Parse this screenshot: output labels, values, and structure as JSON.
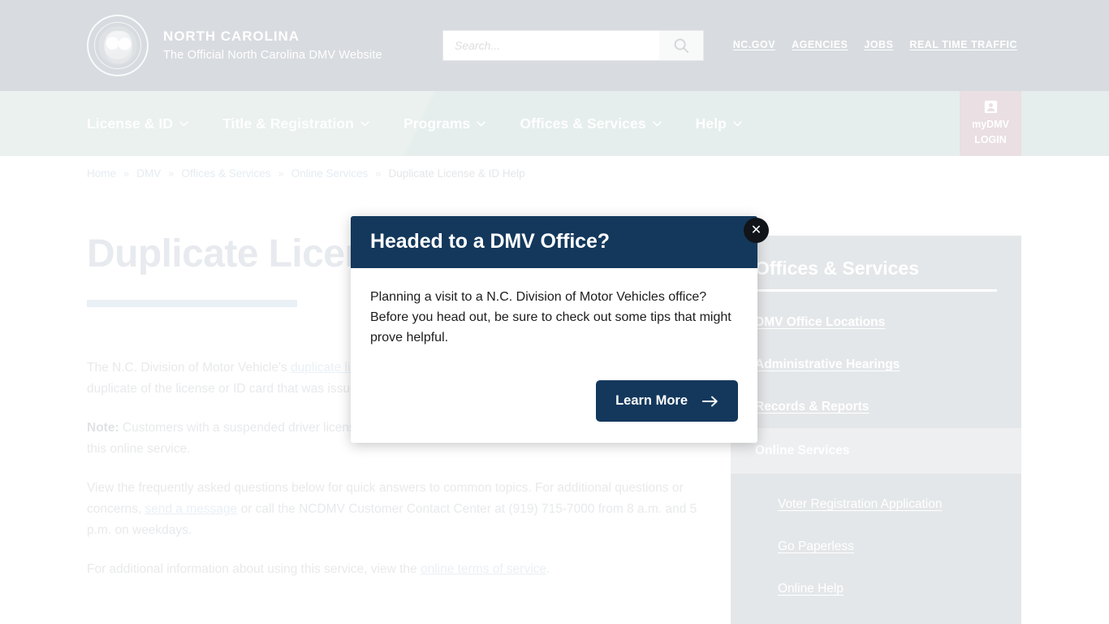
{
  "header": {
    "brand_title": "NORTH CAROLINA",
    "brand_subtitle": "The Official North Carolina DMV Website",
    "seal_icon": "nc-state-seal-icon",
    "search": {
      "placeholder": "Search...",
      "value": "",
      "icon": "search-icon"
    },
    "utility_links": [
      {
        "label": "NC.GOV"
      },
      {
        "label": "AGENCIES"
      },
      {
        "label": "JOBS"
      },
      {
        "label": "REAL TIME TRAFFIC"
      }
    ]
  },
  "nav": {
    "items": [
      {
        "label": "License & ID",
        "icon": "chevron-down-icon"
      },
      {
        "label": "Title & Registration",
        "icon": "chevron-down-icon"
      },
      {
        "label": "Programs",
        "icon": "chevron-down-icon"
      },
      {
        "label": "Offices & Services",
        "icon": "chevron-down-icon"
      },
      {
        "label": "Help",
        "icon": "chevron-down-icon"
      }
    ],
    "login": {
      "icon": "user-account-icon",
      "line1": "myDMV",
      "line2": "LOGIN"
    }
  },
  "breadcrumb": {
    "separator": "»",
    "items": [
      {
        "label": "Home",
        "current": false
      },
      {
        "label": "DMV",
        "current": false
      },
      {
        "label": "Offices & Services",
        "current": false
      },
      {
        "label": "Online Services",
        "current": false
      },
      {
        "label": "Duplicate License & ID Help",
        "current": true
      }
    ]
  },
  "main": {
    "page_title": "Duplicate License & ID Help",
    "paragraphs": {
      "p1_before": "The N.C. Division of Motor Vehicle's ",
      "p1_link": "duplicate license or ID service",
      "p1_after": " allows individuals to purchase online a duplicate of the license or ID card that was issued to them.",
      "p2_label": "Note:",
      "p2_text": " Customers with a suspended driver license or an outstanding debt with NCDMV are not eligible to use this online service.",
      "p3_before": "View the frequently asked questions below for quick answers to common topics. For additional questions or concerns, ",
      "p3_link": "send a message",
      "p3_after": " or call the NCDMV Customer Contact Center at (919) 715-7000 from 8 a.m. and 5 p.m. on weekdays.",
      "p4_before": "For additional information about using this service, view the ",
      "p4_link": "online terms of service",
      "p4_after": "."
    }
  },
  "sidebar": {
    "title": "Offices & Services",
    "links": [
      {
        "label": "DMV Office Locations"
      },
      {
        "label": "Administrative Hearings"
      },
      {
        "label": "Records & Reports"
      }
    ],
    "current": "Online Services",
    "sublinks": [
      {
        "label": "Voter Registration Application"
      },
      {
        "label": "Go Paperless"
      },
      {
        "label": "Online Help"
      }
    ]
  },
  "modal": {
    "title": "Headed to a DMV Office?",
    "close_label": "✕",
    "close_icon": "close-icon",
    "body": "Planning a visit to a N.C. Division of Motor Vehicles office? Before you head out, be sure to check out some tips that might prove helpful.",
    "button_label": "Learn More",
    "button_icon": "arrow-right-icon"
  },
  "colors": {
    "navy": "#13385c",
    "header_band": "#9aa1ab",
    "nav_band": "#bcd2cd",
    "login_band": "#c9aab2",
    "sidebar": "#b9bfc6",
    "sidebar_active": "#d2d6da",
    "title_rule": "#c6d7e6"
  }
}
